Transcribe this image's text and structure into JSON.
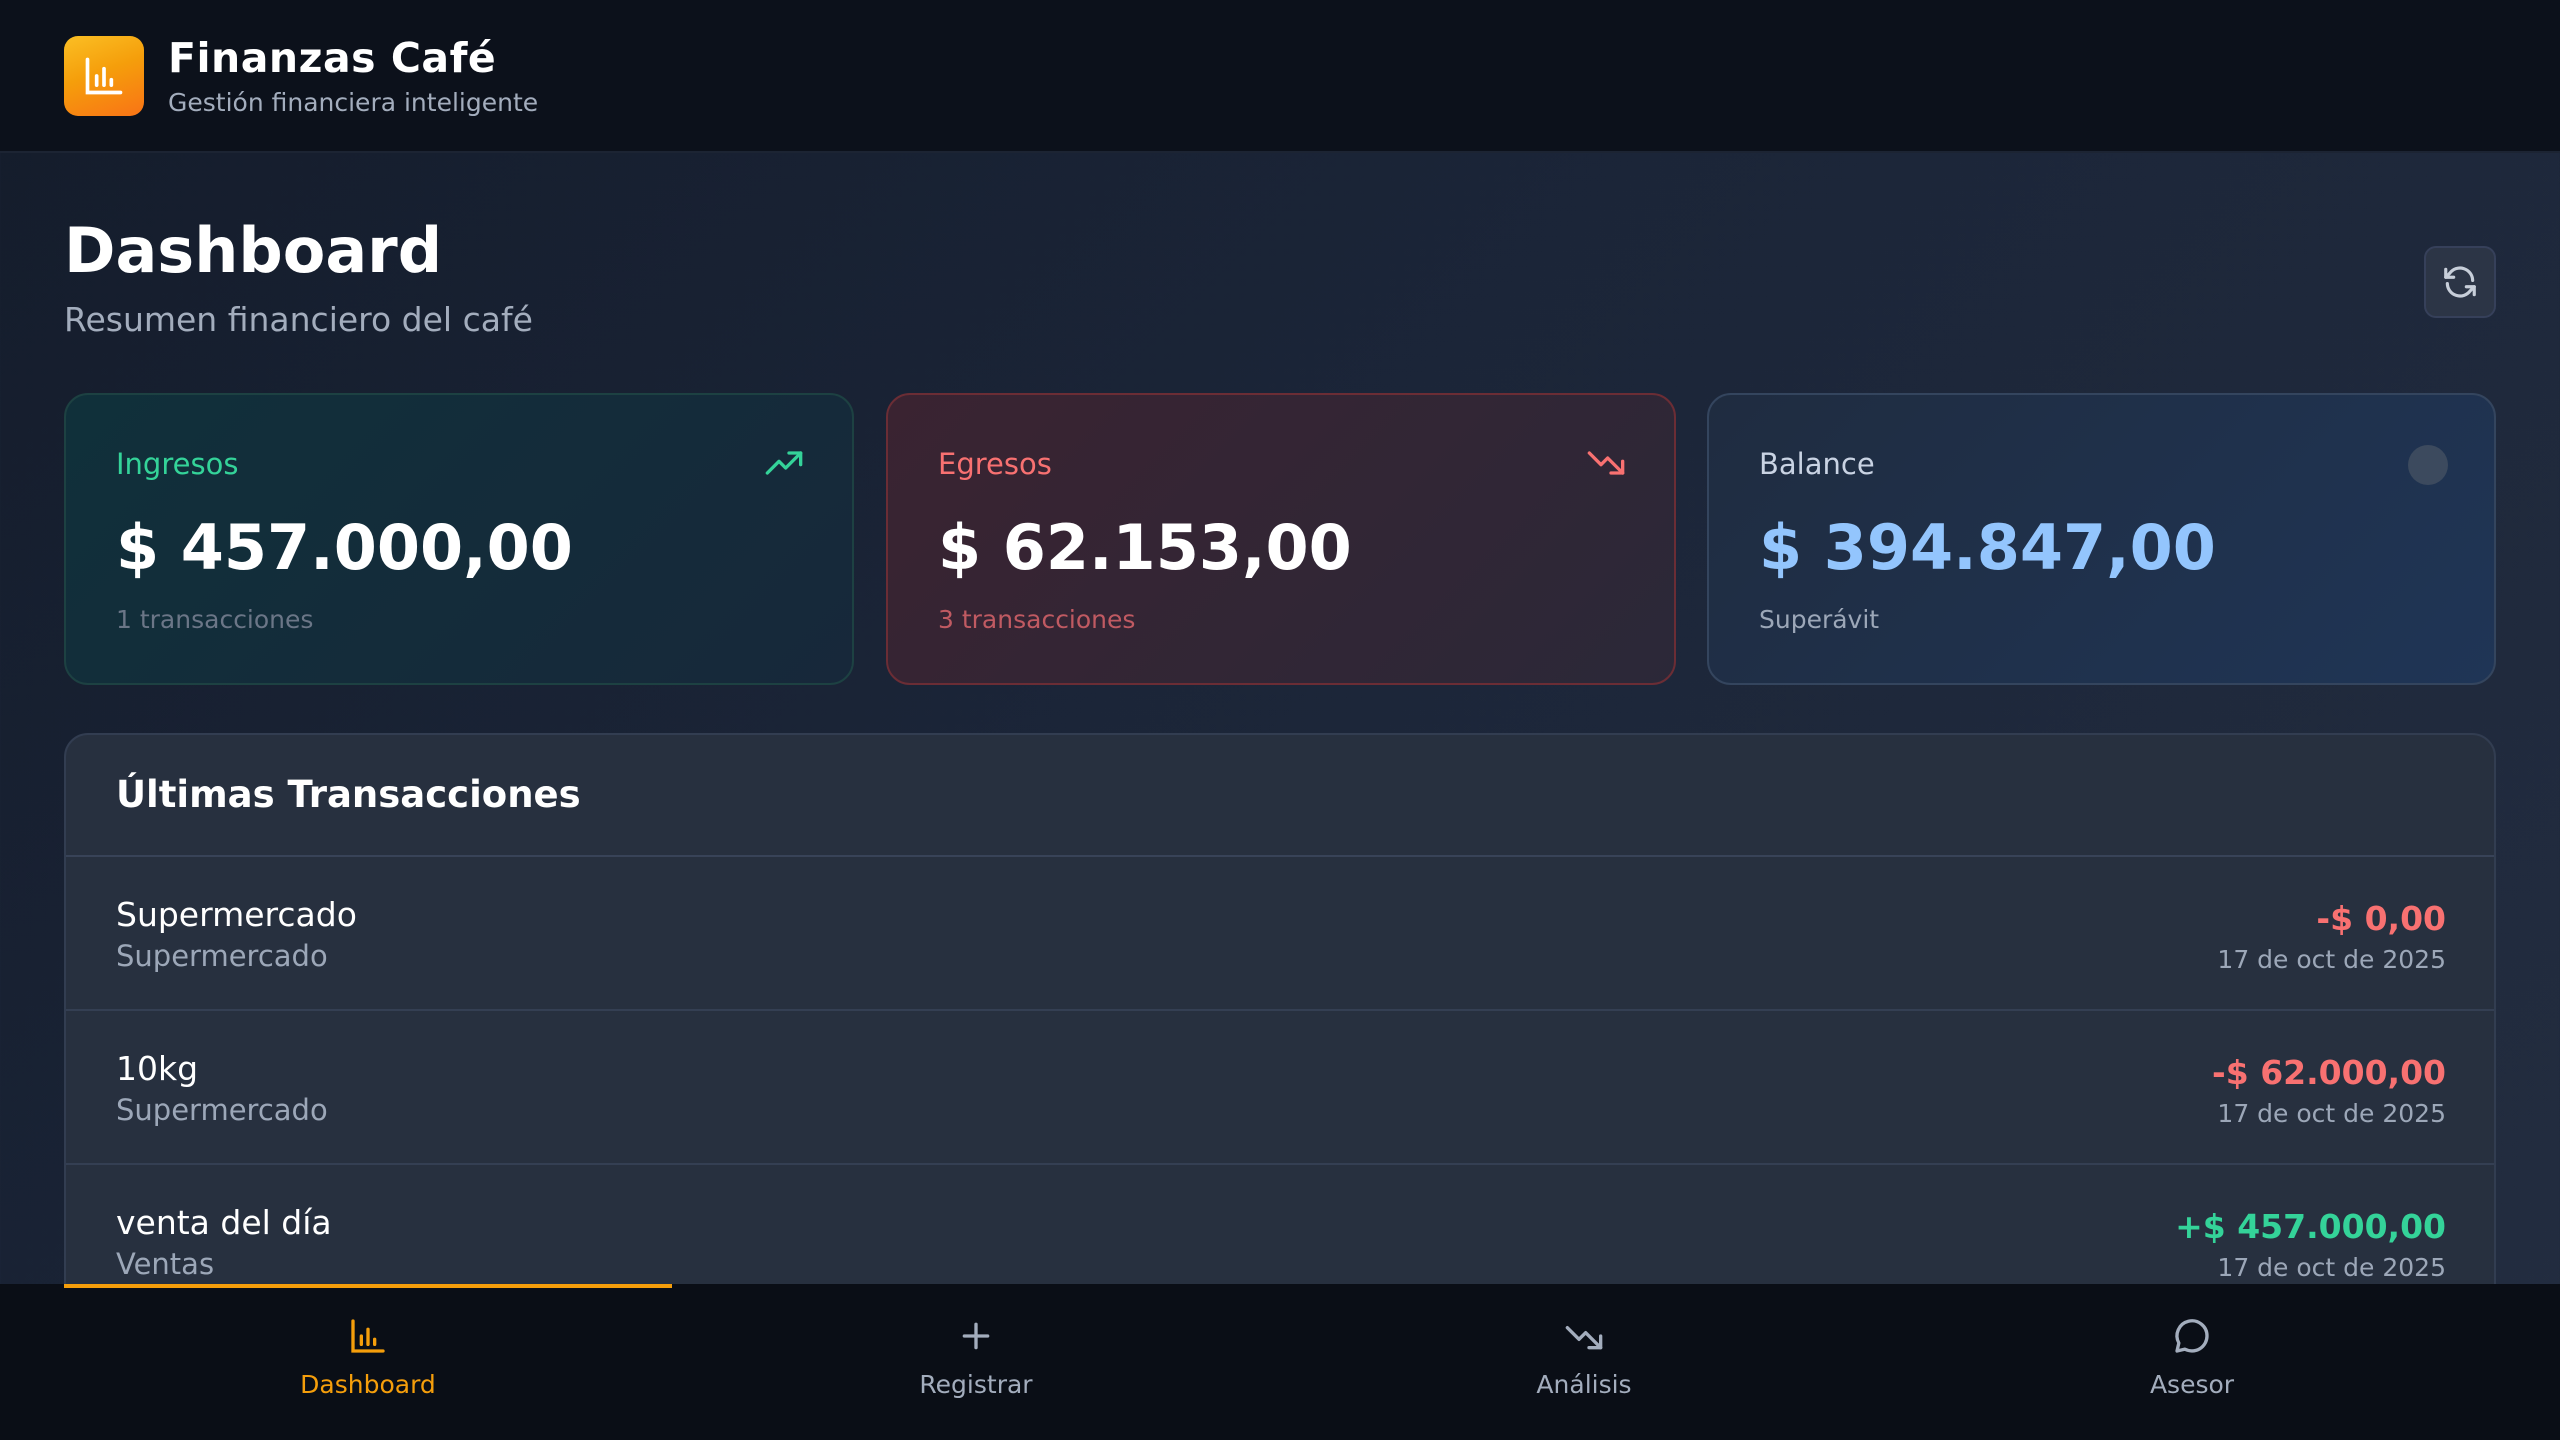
{
  "header": {
    "app_title": "Finanzas Café",
    "app_subtitle": "Gestión financiera inteligente",
    "logo_icon": "bar-chart-icon"
  },
  "page": {
    "title": "Dashboard",
    "subtitle": "Resumen financiero del café",
    "refresh_icon": "refresh-icon"
  },
  "cards": {
    "ingresos": {
      "label": "Ingresos",
      "value": "$ 457.000,00",
      "meta": "1 transacciones",
      "icon": "trending-up-icon",
      "color": "#34d399"
    },
    "egresos": {
      "label": "Egresos",
      "value": "$ 62.153,00",
      "meta": "3 transacciones",
      "icon": "trending-down-icon",
      "color": "#f87171"
    },
    "balance": {
      "label": "Balance",
      "value": "$ 394.847,00",
      "meta": "Superávit",
      "color": "#93c5fd"
    }
  },
  "transactions": {
    "title": "Últimas Transacciones",
    "rows": [
      {
        "name": "Supermercado",
        "category": "Supermercado",
        "amount": "-$ 0,00",
        "date": "17 de oct de 2025",
        "type": "expense"
      },
      {
        "name": "10kg",
        "category": "Supermercado",
        "amount": "-$ 62.000,00",
        "date": "17 de oct de 2025",
        "type": "expense"
      },
      {
        "name": "venta del día",
        "category": "Ventas",
        "amount": "+$ 457.000,00",
        "date": "17 de oct de 2025",
        "type": "income"
      }
    ]
  },
  "nav": {
    "items": [
      {
        "label": "Dashboard",
        "icon": "bar-chart-icon",
        "active": true
      },
      {
        "label": "Registrar",
        "icon": "plus-icon",
        "active": false
      },
      {
        "label": "Análisis",
        "icon": "trending-down-icon",
        "active": false
      },
      {
        "label": "Asesor",
        "icon": "chat-bubble-icon",
        "active": false
      }
    ]
  },
  "colors": {
    "accent": "#f59e0b",
    "income": "#34d399",
    "expense": "#f87171",
    "balance": "#93c5fd"
  }
}
